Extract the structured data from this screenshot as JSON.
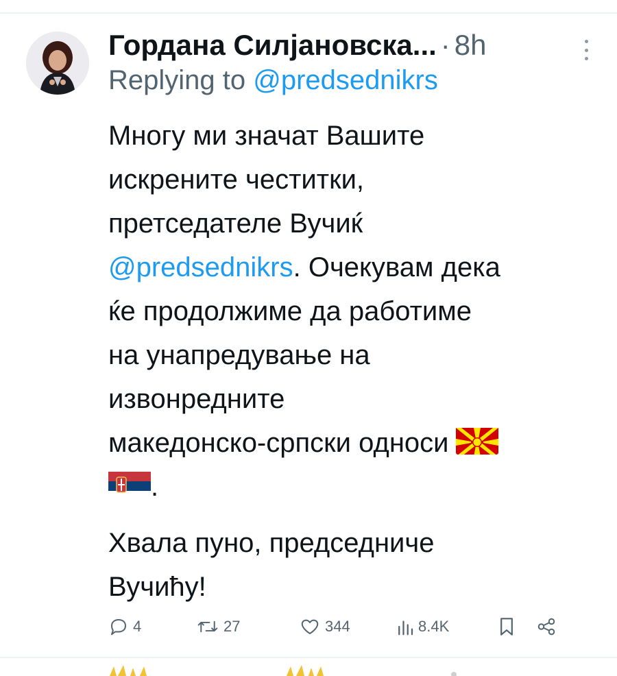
{
  "tweet": {
    "author_name": "Гордана Силјановска...",
    "separator": "·",
    "time": "8h",
    "replying_prefix": "Replying to ",
    "replying_handle": "@predsednikrs",
    "body": {
      "l1": "Многу ми значат Вашите",
      "l2": "искрените честитки,",
      "l3": "претседателе Вучиќ",
      "l4_mention": "@predsednikrs",
      "l4_rest": ". Очекувам дека",
      "l5": "ќе продолжиме да работиме",
      "l6": "на унапредување на",
      "l7": "извонредните",
      "l8": "македонско-српски односи",
      "l9_end": ".",
      "l10": "Хвала пуно, председниче",
      "l11": "Вучићу!"
    },
    "flags": [
      "macedonia-flag",
      "serbia-flag"
    ],
    "actions": {
      "replies": "4",
      "reposts": "27",
      "likes": "344",
      "views": "8.4K"
    }
  },
  "colors": {
    "text": "#0f1419",
    "secondary": "#536471",
    "link": "#1d9bf0",
    "divider": "#eff3f4"
  }
}
